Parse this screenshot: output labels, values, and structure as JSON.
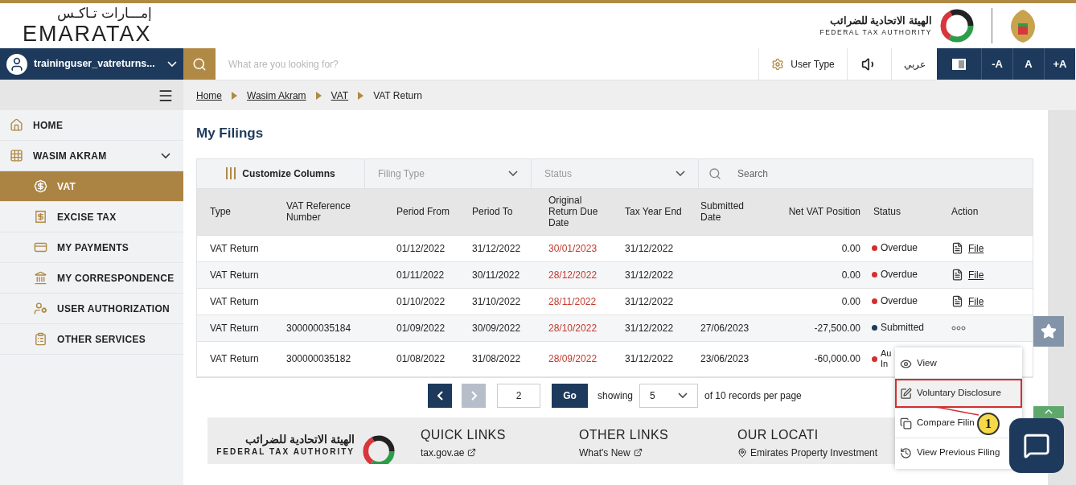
{
  "header": {
    "logo_arabic": "إمـــارات تـاكـس",
    "logo_text": "EMARATAX",
    "authority_arabic": "الهيئة الاتحادية للضرائب",
    "authority_english": "FEDERAL TAX AUTHORITY"
  },
  "topbar": {
    "username": "traininguser_vatreturns...",
    "search_placeholder": "What are you looking for?",
    "user_type": "User Type",
    "language": "عربي",
    "font_buttons": [
      "-A",
      "A",
      "+A"
    ]
  },
  "breadcrumb": [
    {
      "label": "Home",
      "link": true
    },
    {
      "label": "Wasim Akram",
      "link": true
    },
    {
      "label": "VAT",
      "link": true
    },
    {
      "label": "VAT Return",
      "link": false
    }
  ],
  "sidebar": {
    "items": [
      {
        "label": "HOME",
        "selected": false
      },
      {
        "label": "WASIM AKRAM",
        "selected": false,
        "expanded": true,
        "children": [
          {
            "label": "VAT",
            "selected": true
          },
          {
            "label": "EXCISE TAX",
            "selected": false
          },
          {
            "label": "MY PAYMENTS",
            "selected": false
          },
          {
            "label": "MY CORRESPONDENCE",
            "selected": false
          },
          {
            "label": "USER AUTHORIZATION",
            "selected": false
          },
          {
            "label": "OTHER SERVICES",
            "selected": false
          }
        ]
      }
    ]
  },
  "page_title": "My Filings",
  "filters": {
    "customize": "Customize Columns",
    "filing_type": "Filing Type",
    "status": "Status",
    "search_placeholder": "Search"
  },
  "table": {
    "columns": [
      "Type",
      "VAT Reference Number",
      "Period From",
      "Period To",
      "Original Return Due Date",
      "Tax Year End",
      "Submitted Date",
      "Net VAT Position",
      "Status",
      "Action"
    ],
    "rows": [
      {
        "cells": [
          "VAT Return",
          "",
          "01/12/2022",
          "31/12/2022",
          "30/01/2023",
          "31/12/2022",
          "",
          "0.00"
        ],
        "status": "Overdue",
        "color": "#d32f2f",
        "action": {
          "kind": "file",
          "label": "File"
        }
      },
      {
        "cells": [
          "VAT Return",
          "",
          "01/11/2022",
          "30/11/2022",
          "28/12/2022",
          "31/12/2022",
          "",
          "0.00"
        ],
        "status": "Overdue",
        "color": "#d32f2f",
        "action": {
          "kind": "file",
          "label": "File"
        }
      },
      {
        "cells": [
          "VAT Return",
          "",
          "01/10/2022",
          "31/10/2022",
          "28/11/2022",
          "31/12/2022",
          "",
          "0.00"
        ],
        "status": "Overdue",
        "color": "#d32f2f",
        "action": {
          "kind": "file",
          "label": "File"
        }
      },
      {
        "cells": [
          "VAT Return",
          "300000035184",
          "01/09/2022",
          "30/09/2022",
          "28/10/2022",
          "31/12/2022",
          "27/06/2023",
          "-27,500.00"
        ],
        "status": "Submitted",
        "color": "#1d3a5c",
        "action": {
          "kind": "more"
        }
      },
      {
        "cells": [
          "VAT Return",
          "300000035182",
          "01/08/2022",
          "31/08/2022",
          "28/09/2022",
          "31/12/2022",
          "23/06/2023",
          "-60,000.00"
        ],
        "status": "Au In",
        "color": "#d32f2f",
        "action": {
          "kind": "none"
        }
      }
    ]
  },
  "pagination": {
    "prev_disabled": false,
    "next_disabled": true,
    "page": "2",
    "go": "Go",
    "showing": "showing",
    "per_page": "5",
    "suffix": "of 10 records per page"
  },
  "action_menu": [
    {
      "label": "View",
      "highlighted": false
    },
    {
      "label": "Voluntary Disclosure",
      "highlighted": true
    },
    {
      "label": "Compare Filin",
      "highlighted": false
    },
    {
      "label": "View Previous Filing",
      "highlighted": false
    }
  ],
  "callout": "1",
  "footer": {
    "authority_arabic": "الهيئة الاتحادية للضرائب",
    "authority_english": "FEDERAL TAX AUTHORITY",
    "sections": [
      {
        "title": "QUICK LINKS",
        "link": "tax.gov.ae"
      },
      {
        "title": "OTHER LINKS",
        "link": "What's New"
      },
      {
        "title": "OUR LOCATI",
        "link": "Emirates Property Investment"
      }
    ]
  }
}
